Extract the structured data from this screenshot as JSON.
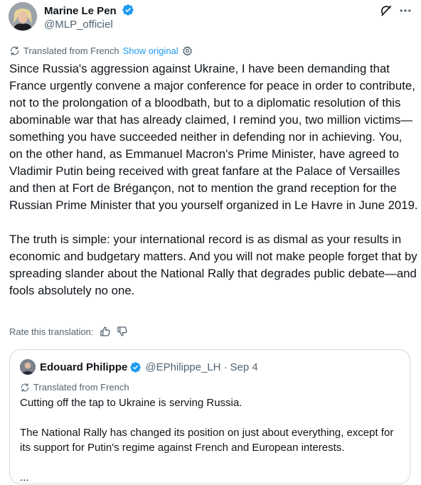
{
  "post": {
    "author_name": "Marine Le Pen",
    "author_handle": "@MLP_officiel",
    "translation": {
      "label": "Translated from French",
      "show_original": "Show original"
    },
    "paragraphs": [
      "Since Russia's aggression against Ukraine, I have been demanding that France urgently convene a major conference for peace in order to contribute, not to the prolongation of a bloodbath, but to a diplomatic resolution of this abominable war that has already claimed, I remind you, two million victims—something you have succeeded neither in defending nor in achieving. You, on the other hand, as Emmanuel Macron's Prime Minister, have agreed to Vladimir Putin being received with great fanfare at the Palace of Versailles and then at Fort de Brégançon, not to mention the grand reception for the Russian Prime Minister that you yourself organized in Le Havre in June 2019.",
      "The truth is simple: your international record is as dismal as your results in economic and budgetary matters. And you will not make people forget that by spreading slander about the National Rally that degrades public debate—and fools absolutely no one."
    ],
    "rate_label": "Rate this translation:"
  },
  "quote": {
    "author_name": "Edouard Philippe",
    "author_handle": "@EPhilippe_LH",
    "separator": "·",
    "date": "Sep 4",
    "translation_label": "Translated from French",
    "paragraphs": [
      "Cutting off the tap to Ukraine is serving Russia.",
      "The National Rally has changed its position on just about everything, except for its support for Putin's regime against French and European interests.",
      "..."
    ]
  },
  "colors": {
    "text": "#0f1419",
    "secondary": "#536471",
    "link": "#1d9bf0",
    "verified": "#1d9bf0",
    "border": "#cfd9de"
  },
  "icons": [
    "verified-badge-icon",
    "grok-icon",
    "more-options-icon",
    "translate-icon",
    "settings-gear-icon",
    "thumbs-up-icon",
    "thumbs-down-icon"
  ]
}
